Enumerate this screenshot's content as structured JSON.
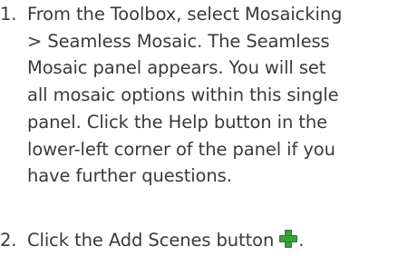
{
  "steps": [
    {
      "number": "1.",
      "lines": [
        "From the Toolbox, select Mosaicking",
        "> Seamless Mosaic. The Seamless",
        "Mosaic panel appears. You will set",
        "all mosaic options within this single",
        "panel. Click the Help button in the",
        "lower-left corner of the panel if you",
        "have further questions."
      ]
    },
    {
      "number": "2.",
      "text": "Click the Add Scenes button",
      "icon": "add-green-plus-icon",
      "trailing": "."
    }
  ],
  "colors": {
    "text": "#3a3a3a",
    "icon_green": "#3aa23a"
  }
}
